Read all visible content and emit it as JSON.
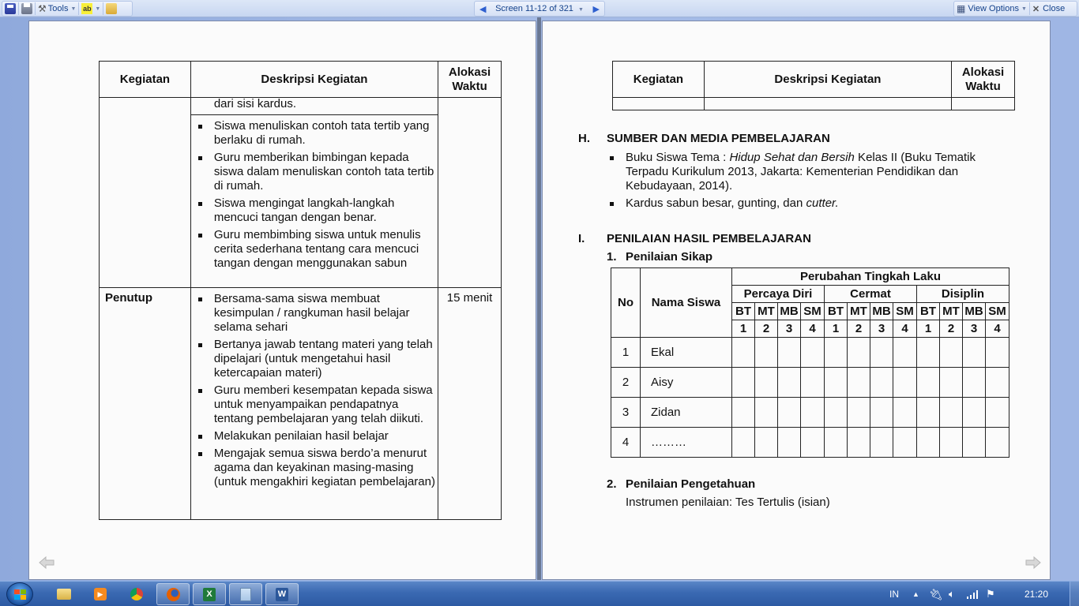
{
  "toolbar": {
    "tools_label": "Tools",
    "navigation": {
      "screen_label": "Screen 11-12 of 321"
    },
    "view_options_label": "View Options",
    "close_label": "Close"
  },
  "left_page": {
    "table": {
      "headers": [
        "Kegiatan",
        "Deskripsi Kegiatan",
        "Alokasi Waktu"
      ],
      "header_alokasi_line1": "Alokasi",
      "header_alokasi_line2": "Waktu",
      "continuation_text": "dari sisi kardus.",
      "inti_items": [
        "Siswa menuliskan contoh tata tertib yang berlaku  di rumah.",
        "Guru  memberikan bimbingan kepada siswa dalam menuliskan contoh tata tertib di rumah.",
        "Siswa mengingat langkah-langkah mencuci   tangan dengan benar.",
        "Guru membimbing siswa untuk menulis cerita    sederhana tentang cara mencuci tangan dengan menggunakan sabun"
      ],
      "penutup": {
        "kegiatan": "Penutup",
        "alokasi": "15 menit",
        "items": [
          "Bersama-sama siswa membuat kesimpulan / rangkuman hasil belajar selama sehari",
          "Bertanya jawab tentang materi yang telah dipelajari (untuk mengetahui hasil ketercapaian materi)",
          "Guru memberi kesempatan kepada siswa untuk menyampaikan pendapatnya tentang pembelajaran yang telah diikuti.",
          "Melakukan penilaian hasil belajar",
          "Mengajak semua siswa berdo’a menurut agama dan keyakinan masing-masing (untuk mengakhiri kegiatan pembelajaran)"
        ]
      }
    }
  },
  "right_page": {
    "table": {
      "headers": [
        "Kegiatan",
        "Deskripsi Kegiatan"
      ],
      "header_alokasi_line1": "Alokasi",
      "header_alokasi_line2": "Waktu"
    },
    "section_h": {
      "number": "H.",
      "title": "SUMBER DAN  MEDIA PEMBELAJARAN",
      "item1_pre": "Buku Siswa Tema : ",
      "item1_italic": "Hidup Sehat dan Bersih",
      "item1_post": " Kelas II (Buku Tematik Terpadu Kurikulum 2013, Jakarta: Kementerian Pendidikan dan Kebudayaan, 2014).",
      "item2_pre": "Kardus  sabun  besar, gunting, dan ",
      "item2_italic": "cutter."
    },
    "section_i": {
      "number": "I.",
      "title": "PENILAIAN HASIL PEMBELAJARAN",
      "sub1_number": "1.",
      "sub1_title": "Penilaian Sikap",
      "sikap_table": {
        "col_no": "No",
        "col_nama": "Nama Siswa",
        "group_header": "Perubahan Tingkah Laku",
        "aspects": [
          "Percaya Diri",
          "Cermat",
          "Disiplin"
        ],
        "levels": [
          "BT",
          "MT",
          "MB",
          "SM"
        ],
        "scores": [
          "1",
          "2",
          "3",
          "4"
        ],
        "rows": [
          {
            "no": "1",
            "nama": "Ekal"
          },
          {
            "no": "2",
            "nama": "Aisy"
          },
          {
            "no": "3",
            "nama": "Zidan"
          },
          {
            "no": "4",
            "nama": "………"
          }
        ]
      },
      "sub2_number": "2.",
      "sub2_title": "Penilaian Pengetahuan",
      "sub2_text": "Instrumen penilaian: Tes Tertulis (isian)"
    }
  },
  "taskbar": {
    "language": "IN",
    "clock": "21:20"
  }
}
